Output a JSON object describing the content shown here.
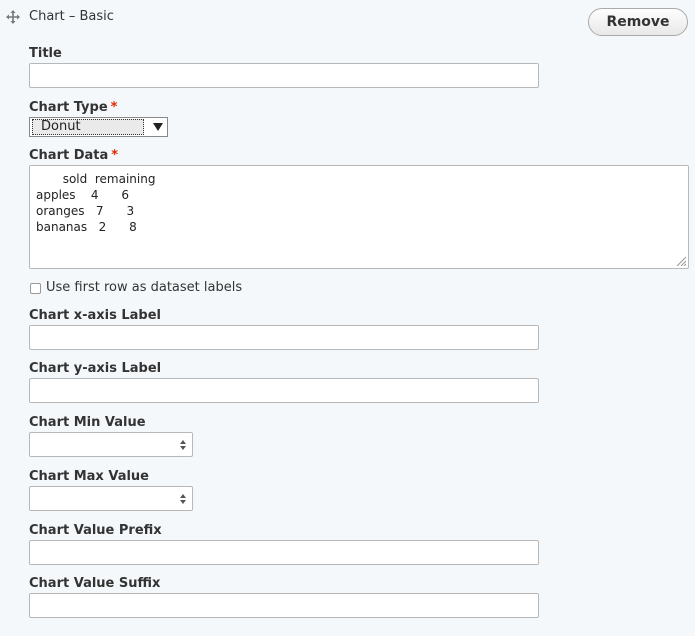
{
  "header": {
    "drag_icon": "move-icon",
    "paragraph_title": "Chart – Basic",
    "remove_label": "Remove"
  },
  "fields": {
    "title": {
      "label": "Title",
      "value": ""
    },
    "chart_type": {
      "label": "Chart Type",
      "required_mark": "*",
      "selected": "Donut"
    },
    "chart_data": {
      "label": "Chart Data",
      "required_mark": "*",
      "value": "       sold  remaining\napples    4      6\noranges   7      3\nbananas   2      8"
    },
    "first_row_labels": {
      "label": "Use first row as dataset labels",
      "checked": false
    },
    "x_axis_label": {
      "label": "Chart x-axis Label",
      "value": ""
    },
    "y_axis_label": {
      "label": "Chart y-axis Label",
      "value": ""
    },
    "min_value": {
      "label": "Chart Min Value",
      "value": ""
    },
    "max_value": {
      "label": "Chart Max Value",
      "value": ""
    },
    "value_prefix": {
      "label": "Chart Value Prefix",
      "value": ""
    },
    "value_suffix": {
      "label": "Chart Value Suffix",
      "value": ""
    }
  },
  "colors": {
    "background": "#f5f8fb",
    "required": "#e32700",
    "border": "#b8b8b8"
  }
}
